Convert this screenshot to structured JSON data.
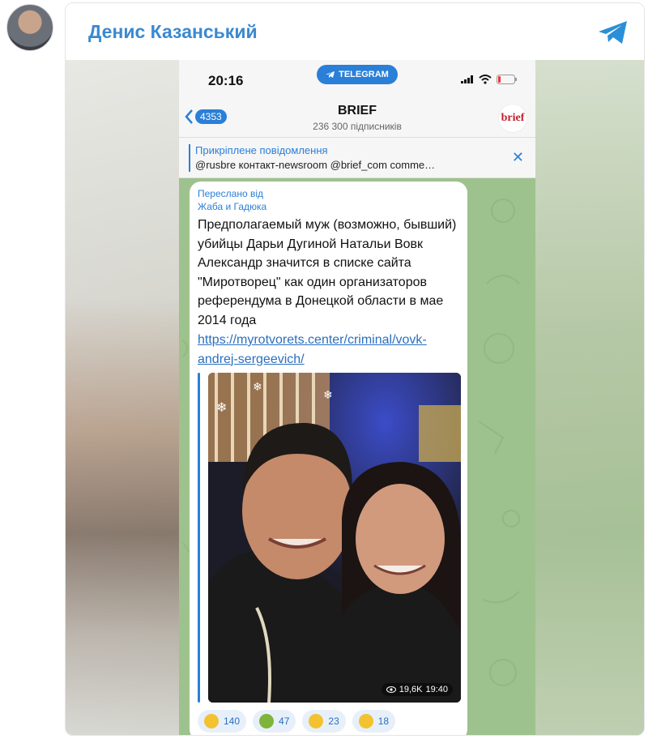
{
  "tweet": {
    "author_name": "Денис Казанський",
    "source_icon": "telegram-icon"
  },
  "phone": {
    "status": {
      "time": "20:16",
      "pill_label": "TELEGRAM"
    },
    "nav": {
      "back_count": "4353",
      "channel_title": "BRIEF",
      "subscribers": "236 300 підписників",
      "avatar_text": "brief"
    },
    "pinned": {
      "title": "Прикріплене повідомлення",
      "text": "@rusbre  контакт-newsroom  @brief_com  comme…"
    },
    "message": {
      "forwarded_label": "Переслано від",
      "forwarded_from": "Жаба и Гадюка",
      "text": "Предполагаемый муж (возможно, бывший) убийцы Дарьи Дугиной Натальи Вовк Александр значится в списке сайта \"Миротворец\" как один организаторов референдума в Донецкой области в мае 2014 года",
      "link": "https://myrotvorets.center/criminal/vovk-andrej-sergeevich/",
      "views": "19,6K",
      "time": "19:40"
    },
    "reactions": [
      {
        "emoji": "thinking-face",
        "count": "140",
        "color": "#f2c230"
      },
      {
        "emoji": "nauseated-face",
        "count": "47",
        "color": "#7fb43a"
      },
      {
        "emoji": "thumbs-up",
        "count": "23",
        "color": "#f2c230"
      },
      {
        "emoji": "screaming-face",
        "count": "18",
        "color": "#f2c230"
      }
    ]
  },
  "colors": {
    "accent": "#2a7fd8",
    "author": "#3a89d1",
    "chat_bg": "#9ec28d"
  }
}
